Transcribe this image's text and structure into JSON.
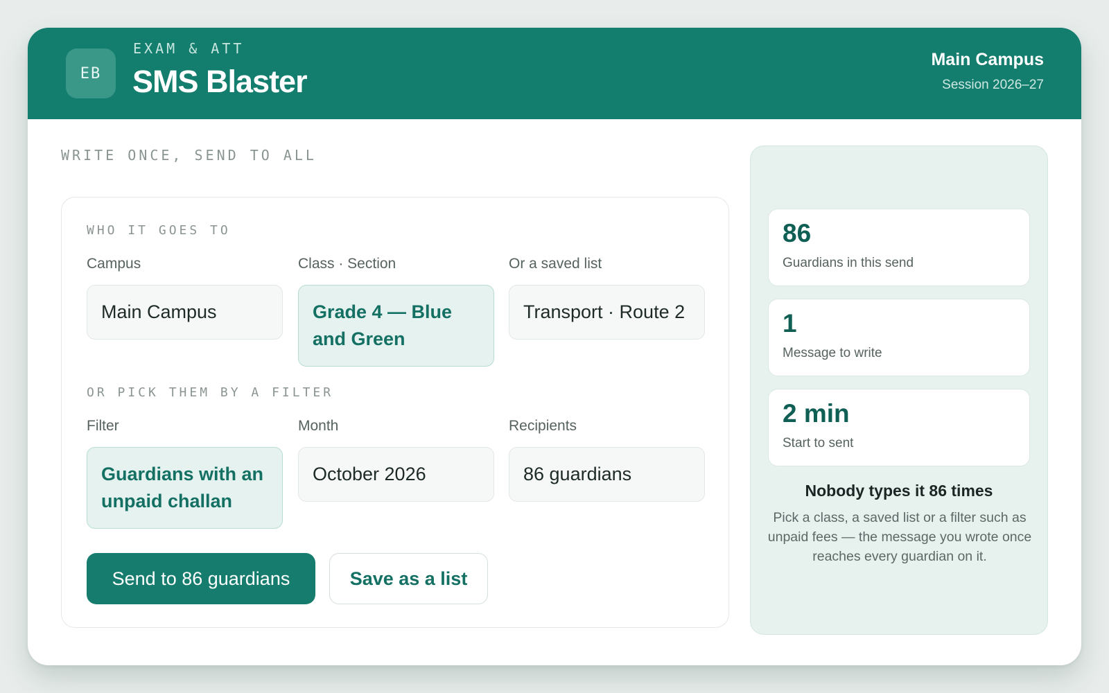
{
  "header": {
    "logo_initials": "EB",
    "eyebrow": "EXAM & ATT",
    "title": "SMS Blaster",
    "campus": "Main Campus",
    "session": "Session 2026–27"
  },
  "main": {
    "eyebrow": "WRITE ONCE, SEND TO ALL",
    "audience": {
      "eyebrow": "WHO IT GOES TO",
      "fields": [
        {
          "label": "Campus",
          "value": "Main Campus",
          "selected": false
        },
        {
          "label": "Class · Section",
          "value": "Grade 4 — Blue and Green",
          "selected": true
        },
        {
          "label": "Or a saved list",
          "value": "Transport · Route 2",
          "selected": false
        }
      ]
    },
    "filter": {
      "eyebrow": "OR PICK THEM BY A FILTER",
      "fields": [
        {
          "label": "Filter",
          "value": "Guardians with an unpaid challan",
          "selected": true
        },
        {
          "label": "Month",
          "value": "October 2026",
          "selected": false
        },
        {
          "label": "Recipients",
          "value": "86 guardians",
          "selected": false
        }
      ]
    },
    "actions": {
      "send_label": "Send to 86 guardians",
      "save_label": "Save as a list"
    }
  },
  "sidebar": {
    "stats": [
      {
        "value": "86",
        "label": "Guardians in this send"
      },
      {
        "value": "1",
        "label": "Message to write"
      },
      {
        "value": "2 min",
        "label": "Start to sent"
      }
    ],
    "title": "Nobody types it 86 times",
    "description": "Pick a class, a saved list or a filter such as unpaid fees — the message you wrote once reaches every guardian on it."
  },
  "colors": {
    "brand": "#137d6e",
    "accent_text": "#137063",
    "selected_bg": "#e6f2ef"
  }
}
